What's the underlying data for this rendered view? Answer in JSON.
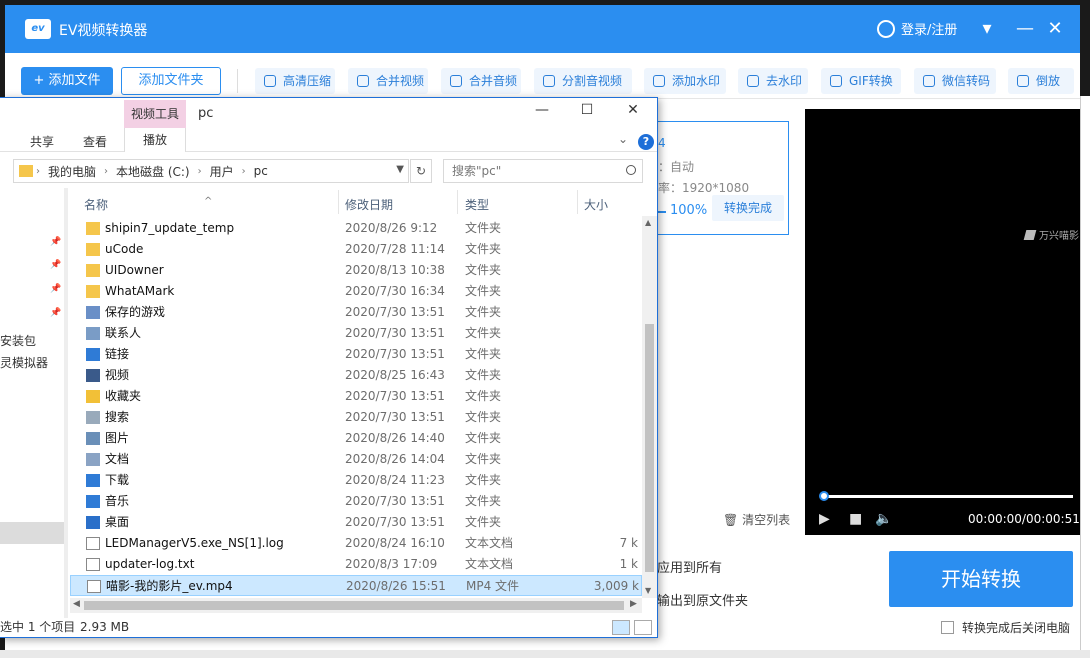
{
  "app": {
    "title": "EV视频转换器",
    "login": "登录/注册",
    "add_file": "+ 添加文件",
    "add_folder": "添加文件夹",
    "tools": [
      "高清压缩",
      "合并视频",
      "合并音频",
      "分割音视频",
      "添加水印",
      "去水印",
      "GIF转换",
      "微信转码",
      "倒放"
    ],
    "item": {
      "line1": "4",
      "line2": "：自动",
      "line3": "率：1920*1080",
      "percent": "100%",
      "done": "转换完成"
    },
    "brand": "万兴喵影",
    "time": "00:00:00/00:00:51",
    "clear_list": "清空列表",
    "apply_all": "应用到所有",
    "output_folder": "输出到原文件夹",
    "start": "开始转换",
    "shutdown": "转换完成后关闭电脑",
    "accent": "#2b8ef0"
  },
  "explorer": {
    "context_tab": "视频工具",
    "title": "pc",
    "tabs": [
      "共享",
      "查看",
      "播放"
    ],
    "path": [
      "我的电脑",
      "本地磁盘 (C:)",
      "用户",
      "pc"
    ],
    "search_placeholder": "搜索\"pc\"",
    "nav": [
      "安装包",
      "灵模拟器"
    ],
    "columns": {
      "name": "名称",
      "date": "修改日期",
      "type": "类型",
      "size": "大小"
    },
    "rows": [
      {
        "icon": "folder-icon",
        "name": "shipin7_update_temp",
        "date": "2020/8/26 9:12",
        "type": "文件夹",
        "size": ""
      },
      {
        "icon": "folder-icon",
        "name": "uCode",
        "date": "2020/7/28 11:14",
        "type": "文件夹",
        "size": ""
      },
      {
        "icon": "folder-icon",
        "name": "UIDowner",
        "date": "2020/8/13 10:38",
        "type": "文件夹",
        "size": ""
      },
      {
        "icon": "folder-icon",
        "name": "WhatAMark",
        "date": "2020/7/30 16:34",
        "type": "文件夹",
        "size": ""
      },
      {
        "icon": "saved-games-icon",
        "name": "保存的游戏",
        "date": "2020/7/30 13:51",
        "type": "文件夹",
        "size": ""
      },
      {
        "icon": "contacts-icon",
        "name": "联系人",
        "date": "2020/7/30 13:51",
        "type": "文件夹",
        "size": ""
      },
      {
        "icon": "links-icon",
        "name": "链接",
        "date": "2020/7/30 13:51",
        "type": "文件夹",
        "size": ""
      },
      {
        "icon": "videos-icon",
        "name": "视频",
        "date": "2020/8/25 16:43",
        "type": "文件夹",
        "size": ""
      },
      {
        "icon": "favorites-icon",
        "name": "收藏夹",
        "date": "2020/7/30 13:51",
        "type": "文件夹",
        "size": ""
      },
      {
        "icon": "searches-icon",
        "name": "搜索",
        "date": "2020/7/30 13:51",
        "type": "文件夹",
        "size": ""
      },
      {
        "icon": "pictures-icon",
        "name": "图片",
        "date": "2020/8/26 14:40",
        "type": "文件夹",
        "size": ""
      },
      {
        "icon": "documents-icon",
        "name": "文档",
        "date": "2020/8/26 14:04",
        "type": "文件夹",
        "size": ""
      },
      {
        "icon": "downloads-icon",
        "name": "下载",
        "date": "2020/8/24 11:23",
        "type": "文件夹",
        "size": ""
      },
      {
        "icon": "music-icon",
        "name": "音乐",
        "date": "2020/7/30 13:51",
        "type": "文件夹",
        "size": ""
      },
      {
        "icon": "desktop-icon",
        "name": "桌面",
        "date": "2020/7/30 13:51",
        "type": "文件夹",
        "size": ""
      },
      {
        "icon": "text-file-icon",
        "name": "LEDManagerV5.exe_NS[1].log",
        "date": "2020/8/24 16:10",
        "type": "文本文档",
        "size": "7 k"
      },
      {
        "icon": "text-file-icon",
        "name": "updater-log.txt",
        "date": "2020/8/3 17:09",
        "type": "文本文档",
        "size": "1 k"
      },
      {
        "icon": "video-file-icon",
        "name": "喵影-我的影片_ev.mp4",
        "date": "2020/8/26 15:51",
        "type": "MP4 文件",
        "size": "3,009 k"
      }
    ],
    "status_sel": "选中 1 个项目",
    "status_size": "2.93 MB"
  }
}
